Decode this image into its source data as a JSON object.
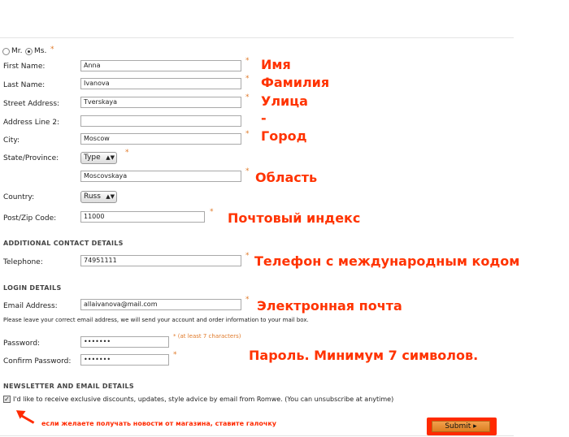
{
  "title": {
    "mr": "Mr.",
    "ms": "Ms."
  },
  "fields": {
    "first_name": {
      "label": "First Name:",
      "value": "Anna",
      "note": "Имя"
    },
    "last_name": {
      "label": "Last Name:",
      "value": "Ivanova",
      "note": "Фамилия"
    },
    "street": {
      "label": "Street Address:",
      "value": "Tverskaya",
      "note": "Улица"
    },
    "address2": {
      "label": "Address Line 2:",
      "value": "",
      "note": "-"
    },
    "city": {
      "label": "City:",
      "value": "Moscow",
      "note": "Город"
    },
    "state": {
      "label": "State/Province:",
      "select": "Type",
      "value": "Moscovskaya",
      "note": "Область"
    },
    "country": {
      "label": "Country:",
      "select": "Russ"
    },
    "postal": {
      "label": "Post/Zip Code:",
      "value": "11000",
      "note": "Почтовый индекс"
    }
  },
  "sections": {
    "contact": "ADDITIONAL CONTACT DETAILS",
    "login": "LOGIN DETAILS",
    "newsletter": "NEWSLETTER AND EMAIL DETAILS"
  },
  "contact": {
    "telephone": {
      "label": "Telephone:",
      "value": "74951111",
      "note": "Телефон с международным кодом"
    }
  },
  "login": {
    "email": {
      "label": "Email Address:",
      "value": "allaivanova@mail.com",
      "note": "Электронная почта"
    },
    "email_help": "Please leave your correct email address, we will send your account and order information to your mail box.",
    "password": {
      "label": "Password:",
      "value": "•••••••",
      "hint": "* (at least 7 characters)"
    },
    "confirm": {
      "label": "Confirm Password:",
      "value": "•••••••"
    },
    "password_note": "Пароль. Минимум 7 символов."
  },
  "newsletter": {
    "checkbox_label": "I'd like to receive exclusive discounts, updates, style advice by email from Romwe. (You can unsubscribe at anytime)",
    "checked": true,
    "hint": "если желаете получать новости от магазина, ставите галочку"
  },
  "submit": {
    "label": "Submit ▸"
  },
  "colors": {
    "annotation": "#ff3300",
    "asterisk": "#e07a2a",
    "submit": "#e08a30"
  }
}
